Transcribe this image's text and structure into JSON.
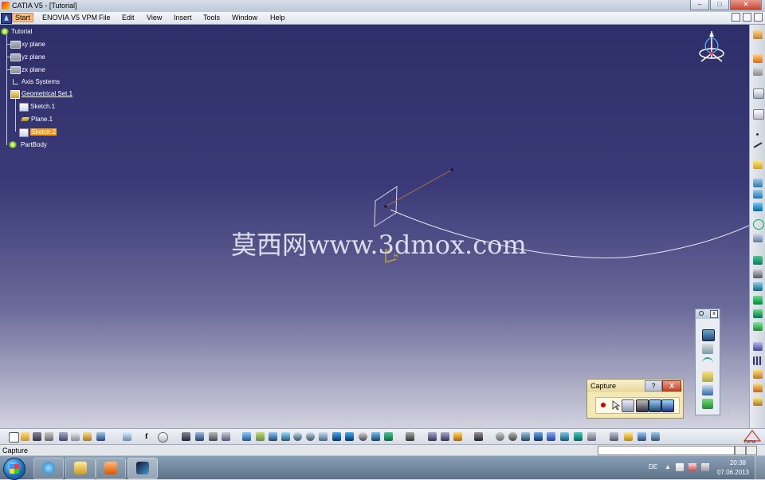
{
  "window": {
    "title": "CATIA V5 - [Tutorial]",
    "min": "–",
    "max": "□",
    "close": "✕"
  },
  "menu": {
    "items": [
      "Start",
      "ENOVIA V5 VPM",
      "File",
      "Edit",
      "View",
      "Insert",
      "Tools",
      "Window",
      "Help"
    ]
  },
  "tree": {
    "root": "Tutorial",
    "nodes": [
      "xy plane",
      "yz plane",
      "zx plane",
      "Axis Systems",
      "Geometrical Set.1",
      "Sketch.1",
      "Plane.1",
      "Sketch.2",
      "PartBody"
    ]
  },
  "viewport": {
    "watermark": "莫西网www.3dmox.com",
    "axis_v": "V",
    "axis_h": "H"
  },
  "floating_toolbar": {
    "title": "O",
    "close": "x"
  },
  "capture": {
    "title": "Capture",
    "help": "?",
    "close": "X"
  },
  "status": {
    "text": "Capture"
  },
  "taskbar": {
    "language": "DE",
    "time": "20:38",
    "date": "07.06.2013"
  },
  "colors": {
    "viewport_top": "#2e2e6a",
    "viewport_bottom": "#d2d2df",
    "selected_node": "#f39b1a"
  }
}
